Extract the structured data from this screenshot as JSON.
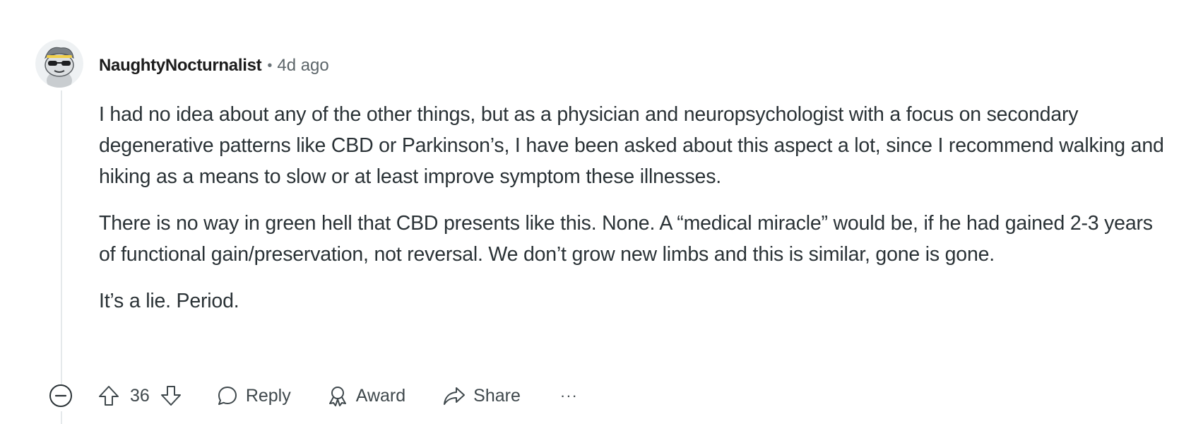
{
  "comment": {
    "author": "NaughtyNocturnalist",
    "separator": "•",
    "time": "4d ago",
    "paragraphs": [
      "I had no idea about any of the other things, but as a physician and neuropsychologist with a focus on secondary degenerative patterns like CBD or Parkinson’s, I have been asked about this aspect a lot, since I recommend walking and hiking as a means to slow or at least improve symptom these illnesses.",
      "There is no way in green hell that CBD presents like this. None. A “medical miracle” would be, if he had gained 2-3 years of functional gain/preservation, not reversal. We don’t grow new limbs and this is similar, gone is gone.",
      "It’s a lie. Period."
    ],
    "actions": {
      "score": "36",
      "reply_label": "Reply",
      "award_label": "Award",
      "share_label": "Share",
      "more_label": "···"
    }
  },
  "icons": {
    "collapse": "minus-circle-icon",
    "upvote": "arrow-up-icon",
    "downvote": "arrow-down-icon",
    "reply": "speech-bubble-icon",
    "award": "award-ribbon-icon",
    "share": "share-arrow-icon",
    "more": "ellipsis-icon"
  },
  "colors": {
    "text": "#2a3236",
    "meta": "#5c6569",
    "thread_line": "#e5e9eb",
    "action": "#3f484c"
  }
}
